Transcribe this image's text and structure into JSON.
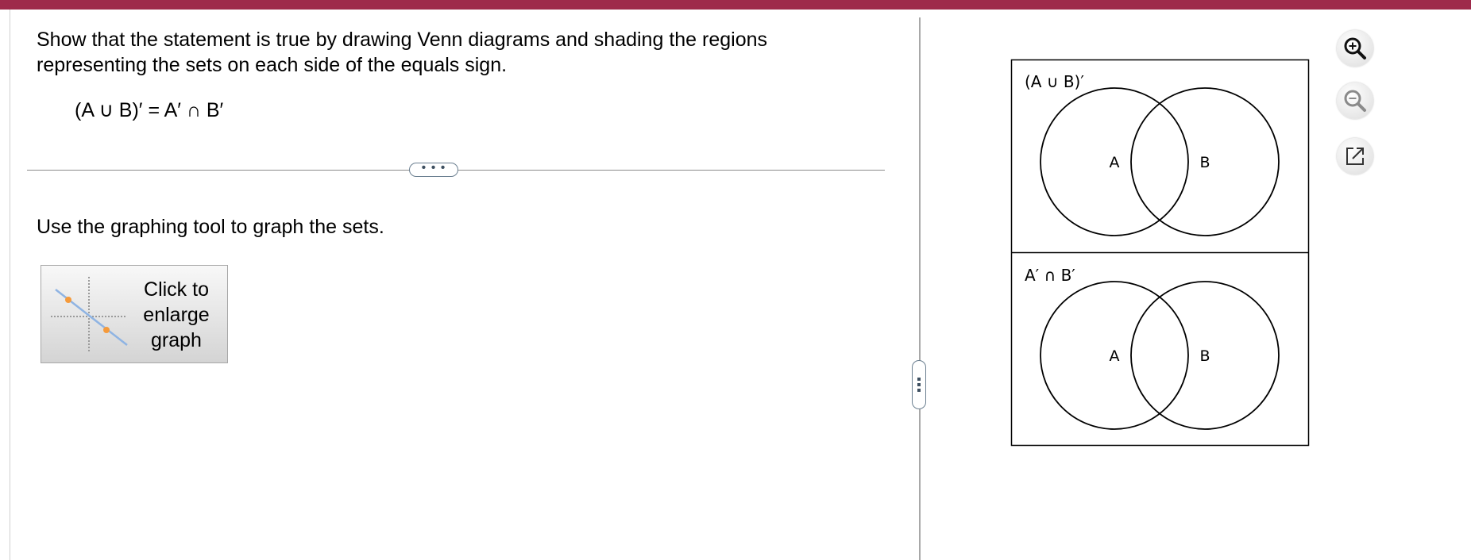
{
  "question": {
    "line1": "Show that the statement is true by drawing Venn diagrams and shading the regions",
    "line2": "representing the sets on each side of the equals sign.",
    "equation": "(A ∪ B)′ = A′ ∩ B′"
  },
  "divider": {
    "expand_label": "• • •"
  },
  "instruction": "Use the graphing tool to graph the sets.",
  "graph_button": {
    "label": "Click to\nenlarge\ngraph"
  },
  "venn": {
    "top": {
      "title": "(A ∪ B)′",
      "label_a": "A",
      "label_b": "B"
    },
    "bottom": {
      "title": "A′ ∩ B′",
      "label_a": "A",
      "label_b": "B"
    }
  },
  "tools": [
    "zoom-in-icon",
    "zoom-out-icon",
    "popout-icon"
  ],
  "colors": {
    "top_bar": "#9e2a4b",
    "accent_orange": "#f59a3b",
    "graph_line": "#8fb4e3"
  }
}
